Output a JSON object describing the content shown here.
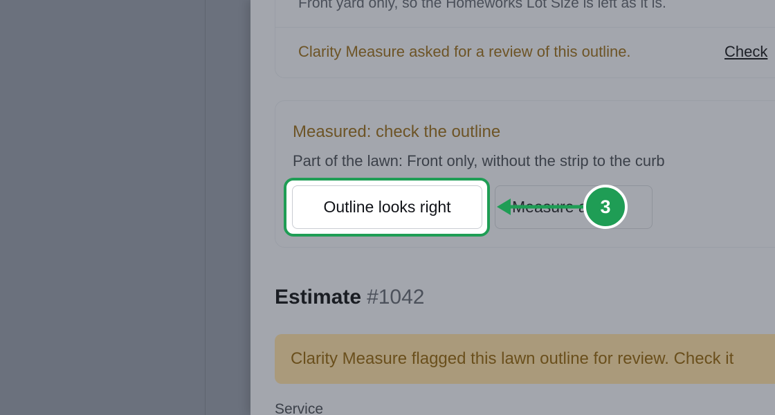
{
  "top_card": {
    "clipped_text": "Front yard only, so the Homeworks Lot Size is left as it is.",
    "review_note": "Clarity Measure asked for a review of this outline.",
    "check_link": "Check"
  },
  "measured_card": {
    "title": "Measured: check the outline",
    "subtitle": "Part of the lawn: Front only, without the strip to the curb",
    "confirm_button": "Outline looks right",
    "measure_button": "Measure again"
  },
  "step_badge": "3",
  "estimate": {
    "heading": "Estimate",
    "number": "#1042",
    "flag_banner": "Clarity Measure flagged this lawn outline for review. Check it",
    "service_label": "Service"
  },
  "colors": {
    "highlight": "#1f9d55",
    "warning_text": "#6d5426"
  }
}
